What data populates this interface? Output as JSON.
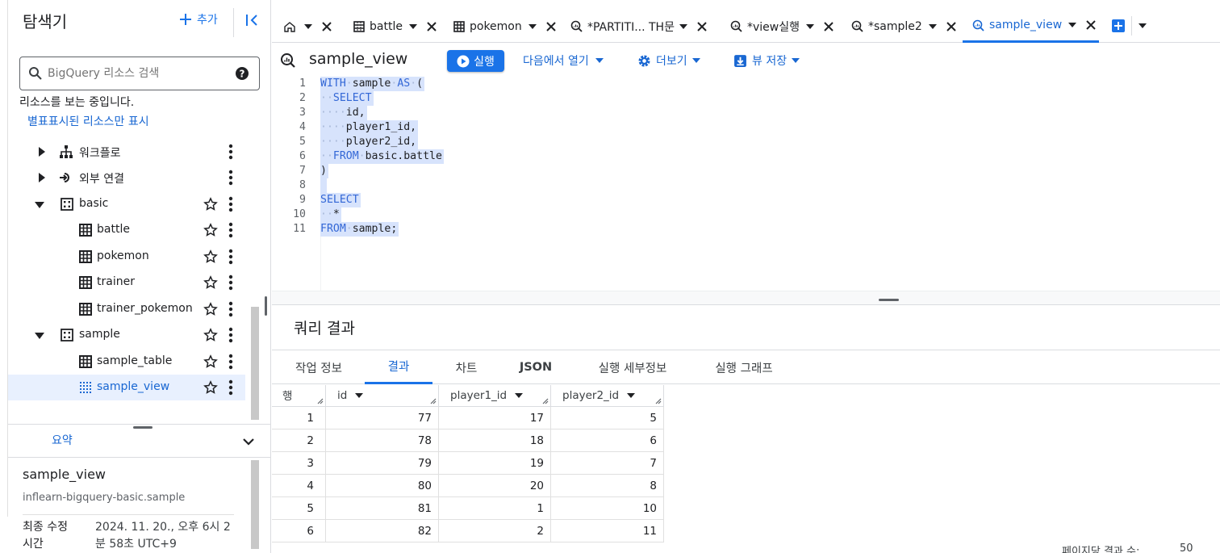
{
  "explorer": {
    "title": "탐색기",
    "add_label": "추가",
    "search_placeholder": "BigQuery 리소스 검색",
    "viewing_text": "리소스를 보는 중입니다.",
    "starred_link": "별표표시된 리소스만 표시",
    "tree": [
      {
        "label": "워크플로",
        "kind": "workflow"
      },
      {
        "label": "외부 연결",
        "kind": "connection"
      },
      {
        "label": "basic",
        "kind": "dataset"
      },
      {
        "label": "battle",
        "kind": "table"
      },
      {
        "label": "pokemon",
        "kind": "table"
      },
      {
        "label": "trainer",
        "kind": "table"
      },
      {
        "label": "trainer_pokemon",
        "kind": "table"
      },
      {
        "label": "sample",
        "kind": "dataset"
      },
      {
        "label": "sample_table",
        "kind": "table"
      },
      {
        "label": "sample_view",
        "kind": "view",
        "selected": true
      }
    ]
  },
  "summary": {
    "title": "요약",
    "name": "sample_view",
    "path": "inflearn-bigquery-basic.sample",
    "modified_label_1": "최종 수정",
    "modified_label_2": "시간",
    "modified_value_1": "2024. 11. 20., 오후 6시 2",
    "modified_value_2": "분 58초 UTC+9"
  },
  "tabs": [
    {
      "label": ""
    },
    {
      "label": "battle"
    },
    {
      "label": "pokemon"
    },
    {
      "label": "*PARTITI...  TH문"
    },
    {
      "label": "*view실행"
    },
    {
      "label": "*sample2"
    },
    {
      "label": "sample_view",
      "active": true
    }
  ],
  "toolbar": {
    "title": "sample_view",
    "run_label": "실행",
    "open_in_label": "다음에서 열기",
    "more_label": "더보기",
    "save_view_label": "뷰 저장"
  },
  "editor": {
    "lines": [
      "WITH sample AS (",
      "  SELECT",
      "    id,",
      "    player1_id,",
      "    player2_id,",
      "  FROM basic.battle",
      ")",
      "",
      "SELECT",
      "  *",
      "FROM sample;"
    ]
  },
  "results": {
    "title": "쿼리 결과",
    "tabs": [
      "작업 정보",
      "결과",
      "차트",
      "JSON",
      "실행 세부정보",
      "실행 그래프"
    ],
    "active_tab": "결과",
    "columns": [
      "행",
      "id",
      "player1_id",
      "player2_id"
    ],
    "rows": [
      [
        1,
        77,
        17,
        5
      ],
      [
        2,
        78,
        18,
        6
      ],
      [
        3,
        79,
        19,
        7
      ],
      [
        4,
        80,
        20,
        8
      ],
      [
        5,
        81,
        1,
        10
      ],
      [
        6,
        82,
        2,
        11
      ]
    ],
    "page_size_label": "페이지당 결과 수:",
    "page_size": "50"
  },
  "colors": {
    "accent": "#1a73e8",
    "selection": "#d7e3fc"
  }
}
